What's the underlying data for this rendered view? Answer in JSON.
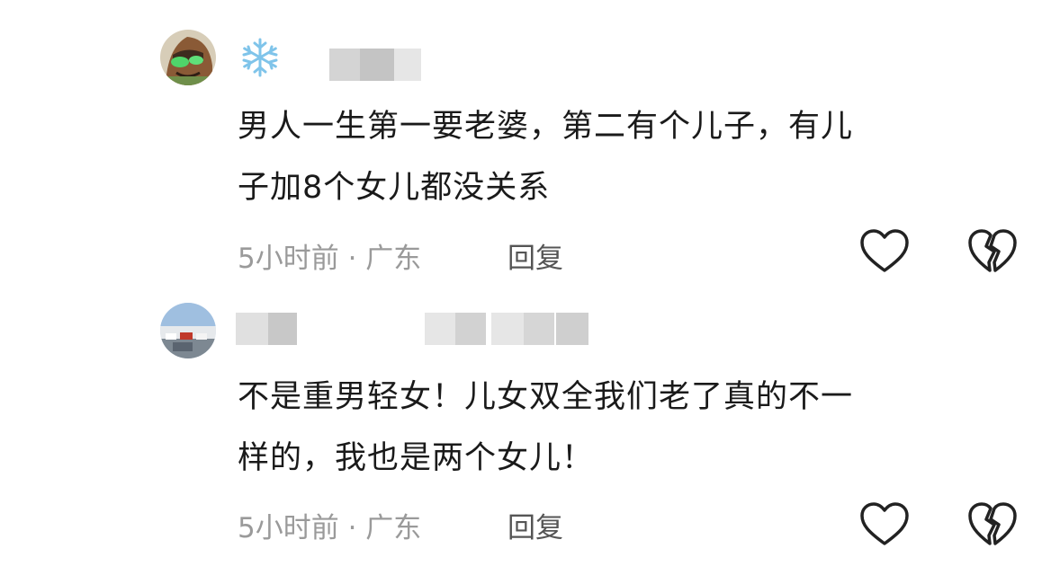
{
  "comments": [
    {
      "avatar": "cartoon-avatar",
      "name_icon": "snowflake-icon",
      "text_lines": [
        "男人一生第一要老婆，第二有个儿子，有儿",
        "子加8个女儿都没关系"
      ],
      "time_location": "5小时前 · 广东",
      "reply_label": "回复"
    },
    {
      "avatar": "photo-avatar-cars",
      "text_lines": [
        "不是重男轻女！儿女双全我们老了真的不一",
        "样的，我也是两个女儿！"
      ],
      "time_location": "5小时前 · 广东",
      "reply_label": "回复"
    }
  ],
  "icons": {
    "like": "heart-outline-icon",
    "dislike": "broken-heart-icon"
  }
}
